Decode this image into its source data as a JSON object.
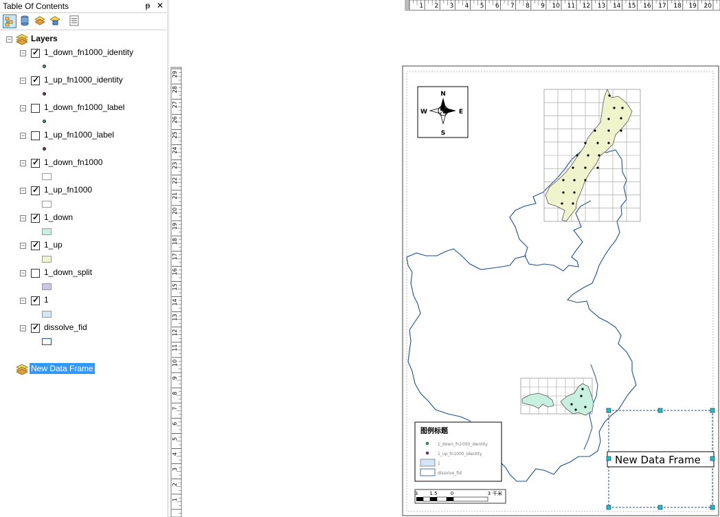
{
  "toc": {
    "title": "Table Of Contents",
    "pin_glyph": "ᵽ",
    "close_glyph": "✕",
    "toolbar": [
      {
        "name": "list-by-drawing-order-icon"
      },
      {
        "name": "list-by-source-icon"
      },
      {
        "name": "list-by-visibility-icon"
      },
      {
        "name": "list-by-selection-icon"
      },
      {
        "name": "options-icon"
      }
    ],
    "root_label": "Layers",
    "layers": [
      {
        "label": "1_down_fn1000_identity",
        "checked": true,
        "symbol": "dot",
        "color": "#2eab5a"
      },
      {
        "label": "1_up_fn1000_identity",
        "checked": true,
        "symbol": "dot",
        "color": "#7a2a9a"
      },
      {
        "label": "1_down_fn1000_label",
        "checked": false,
        "symbol": "dot",
        "color": "#2eab5a"
      },
      {
        "label": "1_up_fn1000_label",
        "checked": false,
        "symbol": "dot",
        "color": "#b01d2a"
      },
      {
        "label": "1_down_fn1000",
        "checked": true,
        "symbol": "box",
        "color": "#ffffff"
      },
      {
        "label": "1_up_fn1000",
        "checked": true,
        "symbol": "box",
        "color": "#ffffff"
      },
      {
        "label": "1_down",
        "checked": true,
        "symbol": "box",
        "color": "#c8f0e0"
      },
      {
        "label": "1_up",
        "checked": true,
        "symbol": "box",
        "color": "#f0f4cc"
      },
      {
        "label": "1_down_split",
        "checked": false,
        "symbol": "box",
        "color": "#c9c6ea"
      },
      {
        "label": "1",
        "checked": true,
        "symbol": "box",
        "color": "#d3e6f7"
      },
      {
        "label": "dissolve_fid",
        "checked": true,
        "symbol": "boxo",
        "color": "#1d4f8c"
      }
    ],
    "second_frame_label": "New Data Frame",
    "selection_color": "#3399ff"
  },
  "rulers": {
    "horizontal": [
      "1",
      "2",
      "3",
      "4",
      "5",
      "6",
      "7",
      "8",
      "9",
      "10",
      "11",
      "12",
      "13",
      "14",
      "15",
      "16",
      "17",
      "18",
      "19",
      "20"
    ],
    "vertical": [
      "29",
      "28",
      "27",
      "26",
      "25",
      "24",
      "23",
      "22",
      "21",
      "20",
      "19",
      "18",
      "17",
      "16",
      "15",
      "14",
      "13",
      "12",
      "11",
      "10",
      "9",
      "8",
      "7",
      "6",
      "5",
      "4",
      "3",
      "2",
      "1"
    ]
  },
  "map": {
    "north_arrow": {
      "n": "N",
      "s": "S",
      "e": "E",
      "w": "W"
    },
    "legend": {
      "title": "图例标题",
      "items": [
        {
          "label": "1_down_fn1000_identity",
          "symbol": "dot",
          "color": "#2eab5a"
        },
        {
          "label": "1_up_fn1000_identity",
          "symbol": "dot",
          "color": "#7a2a9a"
        },
        {
          "label": "1",
          "symbol": "box",
          "color": "#d3e6f7"
        },
        {
          "label": "dissolve_fid",
          "symbol": "boxo",
          "color": "#1d4f8c"
        }
      ]
    },
    "scalebar": {
      "labels": [
        "3",
        "1.5",
        "0",
        "3"
      ],
      "unit": "千米"
    },
    "new_frame_label": "New Data Frame",
    "colors": {
      "river": "#1a4f8c",
      "up_fill": "#f0f4cc",
      "down_fill": "#c8f0e0",
      "grid": "#999999",
      "handle": "#2bb8c8"
    }
  }
}
